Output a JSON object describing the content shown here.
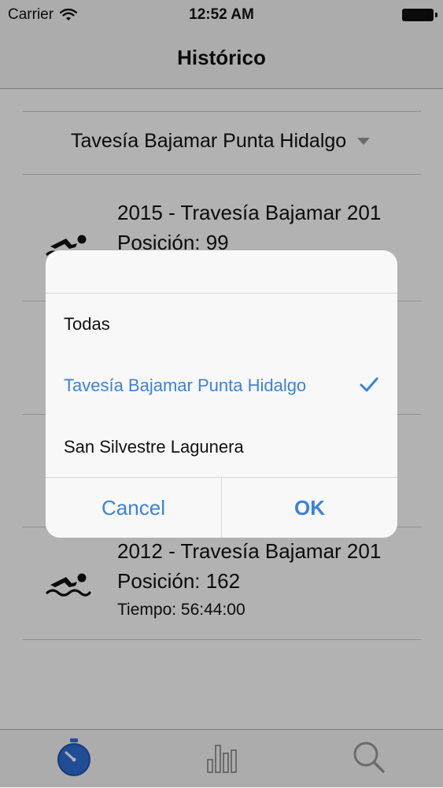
{
  "status_bar": {
    "carrier": "Carrier",
    "time": "12:52 AM"
  },
  "nav": {
    "title": "Histórico"
  },
  "filter": {
    "selected": "Tavesía Bajamar Punta Hidalgo"
  },
  "results": [
    {
      "title": "2015 - Travesía Bajamar 201",
      "position": "Posición: 99"
    },
    {
      "title": "2012 - Travesía Bajamar 201",
      "position": "Posición: 162",
      "time": "Tiempo: 56:44:00"
    }
  ],
  "dialog": {
    "options": [
      {
        "label": "Todas",
        "selected": false
      },
      {
        "label": "Tavesía Bajamar Punta Hidalgo",
        "selected": true
      },
      {
        "label": "San Silvestre Lagunera",
        "selected": false
      }
    ],
    "cancel_label": "Cancel",
    "ok_label": "OK"
  },
  "tabbar": {
    "items": [
      "stopwatch-icon",
      "bar-chart-icon",
      "search-icon"
    ],
    "active": 0
  },
  "colors": {
    "accent": "#3b82d8",
    "separator": "#cfcfcf",
    "bar_bg": "#f7f7f7"
  }
}
